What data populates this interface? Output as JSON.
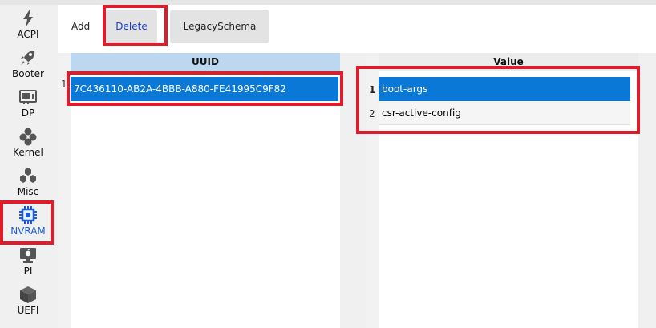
{
  "sidebar": {
    "items": [
      {
        "label": "ACPI",
        "icon": "lightning-icon"
      },
      {
        "label": "Booter",
        "icon": "rocket-icon"
      },
      {
        "label": "DP",
        "icon": "display-card-icon"
      },
      {
        "label": "Kernel",
        "icon": "kernel-icon"
      },
      {
        "label": "Misc",
        "icon": "hexagons-icon"
      },
      {
        "label": "NVRAM",
        "icon": "chip-icon",
        "active": true
      },
      {
        "label": "PI",
        "icon": "apple-monitor-icon"
      },
      {
        "label": "UEFI",
        "icon": "cube-icon"
      }
    ]
  },
  "toolbar": {
    "add_label": "Add",
    "delete_label": "Delete",
    "legacy_label": "LegacySchema"
  },
  "left_table": {
    "header": "UUID",
    "rows": [
      {
        "num": "1",
        "value": "7C436110-AB2A-4BBB-A880-FE41995C9F82"
      }
    ]
  },
  "right_table": {
    "header": "Value",
    "rows": [
      {
        "num": "1",
        "value": "boot-args"
      },
      {
        "num": "2",
        "value": "csr-active-config"
      }
    ]
  },
  "colors": {
    "accent": "#0a78d7",
    "active_text": "#1a5bd6",
    "annotation": "#e01b2a",
    "header_selected": "#bcd8f0"
  }
}
